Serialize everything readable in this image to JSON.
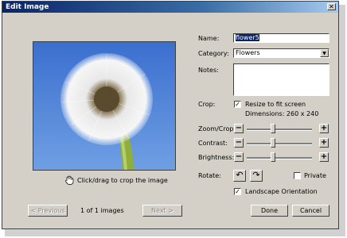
{
  "window": {
    "title": "Edit Image",
    "close_glyph": "✕"
  },
  "preview": {
    "hint": "Click/drag to crop the image",
    "hint_icon": "hand-icon"
  },
  "form": {
    "name_label": "Name:",
    "name_value": "flower5",
    "category_label": "Category:",
    "category_value": "Flowers",
    "notes_label": "Notes:",
    "notes_value": "",
    "crop_label": "Crop:",
    "resize_label": "Resize to fit screen",
    "resize_checked": true,
    "dimensions": "Dimensions: 260 x 240",
    "zoom_label": "Zoom/Crop:",
    "contrast_label": "Contrast:",
    "brightness_label": "Brightness:",
    "zoom_level": 0.4,
    "contrast_level": 0.4,
    "brightness_level": 0.4,
    "rotate_label": "Rotate:",
    "private_label": "Private",
    "private_checked": false,
    "landscape_label": "Landscape Orientation",
    "landscape_checked": true,
    "minus": "−",
    "plus": "+",
    "check": "✓"
  },
  "footer": {
    "previous": "< Previous",
    "count": "1 of 1 images",
    "next": "Next >",
    "done": "Done",
    "cancel": "Cancel"
  }
}
